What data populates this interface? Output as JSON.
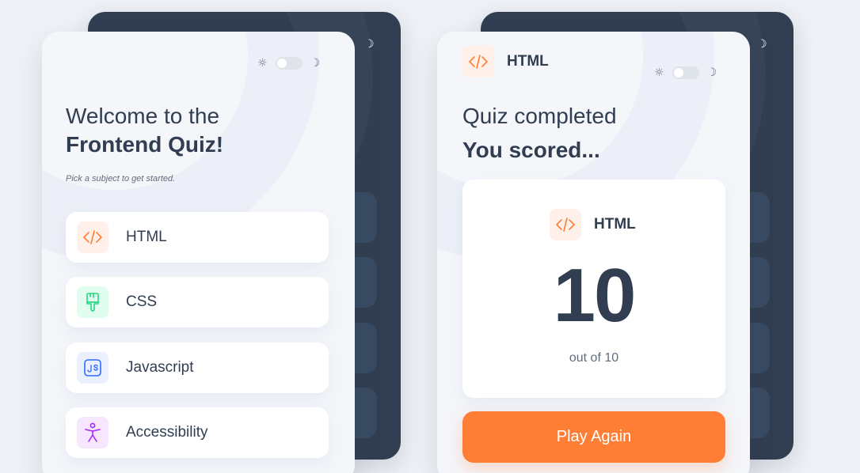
{
  "colors": {
    "background": "#eef1f6",
    "dark_card": "#313e51",
    "light_card": "#f4f6fa",
    "html_accent": "#ff7e35",
    "css_accent": "#26d782",
    "js_accent": "#306aff",
    "a11y_accent": "#a729f5",
    "play_button": "#ff7e35"
  },
  "theme": {
    "light_icon": "sun-icon",
    "dark_icon": "moon-icon",
    "sun_glyph": "☼",
    "moon_glyph": "☽",
    "dark_mode_enabled": false
  },
  "welcome": {
    "title_light": "Welcome to the",
    "title_bold": "Frontend Quiz!",
    "subtitle": "Pick a subject to get started.",
    "subjects": [
      {
        "label": "HTML",
        "icon": "html-code-icon",
        "tile_color": "#fff1e9"
      },
      {
        "label": "CSS",
        "icon": "paintbrush-icon",
        "tile_color": "#e0fdef"
      },
      {
        "label": "Javascript",
        "icon": "js-icon",
        "tile_color": "#ebf0ff"
      },
      {
        "label": "Accessibility",
        "icon": "accessibility-icon",
        "tile_color": "#f6e7ff"
      }
    ]
  },
  "result": {
    "subject_label": "HTML",
    "title_light": "Quiz completed",
    "title_bold": "You scored...",
    "score": "10",
    "out_of": "out of 10",
    "play_again": "Play Again"
  }
}
